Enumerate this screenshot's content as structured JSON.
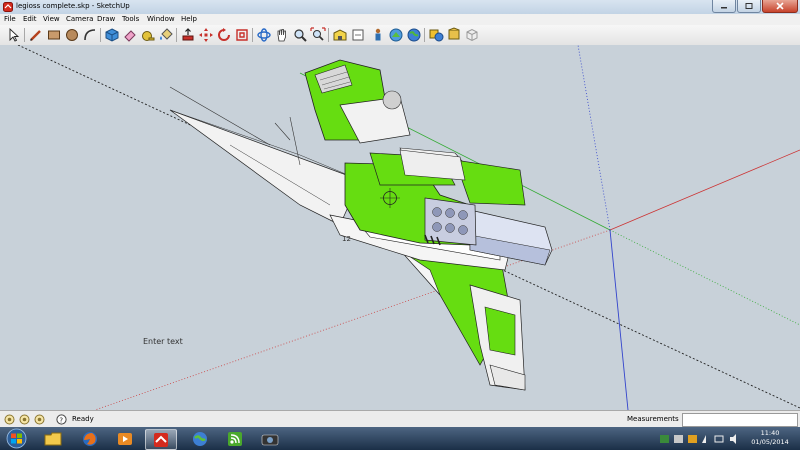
{
  "window": {
    "title": "legioss complete.skp - SketchUp"
  },
  "menu": [
    "File",
    "Edit",
    "View",
    "Camera",
    "Draw",
    "Tools",
    "Window",
    "Help"
  ],
  "toolbar": {
    "tools": [
      "select",
      "line",
      "rectangle",
      "circle",
      "arc",
      "make-component",
      "eraser",
      "tape-measure",
      "paint-bucket",
      "push-pull",
      "move",
      "rotate",
      "offset",
      "orbit",
      "pan",
      "zoom",
      "zoom-extents",
      "get-models",
      "share-model",
      "share-component",
      "get-photo-textures",
      "google-earth-toggle",
      "preview-in-google-earth",
      "styles",
      "shaded",
      "xray"
    ]
  },
  "canvas": {
    "floating_text": "Enter text",
    "model_label": "12"
  },
  "status": {
    "ready_text": "Ready",
    "measurements_label": "Measurements",
    "measurements_value": ""
  },
  "taskbar": {
    "apps": [
      "windows-explorer",
      "firefox",
      "media-player",
      "sketchup",
      "google-earth",
      "feed-reader",
      "camera-app"
    ],
    "time": "11:40",
    "date": "01/05/2014"
  },
  "colors": {
    "model_green": "#66dd11",
    "canvas_bg": "#c8d1d9",
    "axis_red": "#cc3333",
    "axis_green": "#33aa33",
    "axis_blue": "#3344cc"
  }
}
